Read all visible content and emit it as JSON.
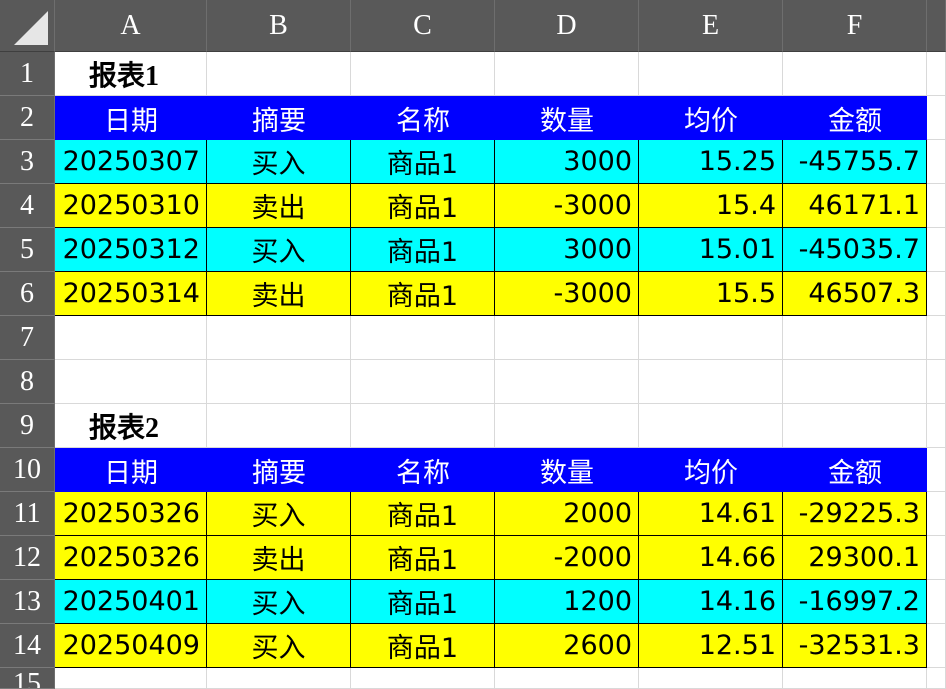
{
  "sheet": {
    "columns": [
      "A",
      "B",
      "C",
      "D",
      "E",
      "F"
    ],
    "rows": [
      "1",
      "2",
      "3",
      "4",
      "5",
      "6",
      "7",
      "8",
      "9",
      "10",
      "11",
      "12",
      "13",
      "14",
      "15"
    ],
    "report1": {
      "title": "报表1",
      "headers": [
        "日期",
        "摘要",
        "名称",
        "数量",
        "均价",
        "金额"
      ],
      "rows": [
        [
          "20250307",
          "买入",
          "商品1",
          "3000",
          "15.25",
          "-45755.7"
        ],
        [
          "20250310",
          "卖出",
          "商品1",
          "-3000",
          "15.4",
          "46171.1"
        ],
        [
          "20250312",
          "买入",
          "商品1",
          "3000",
          "15.01",
          "-45035.7"
        ],
        [
          "20250314",
          "卖出",
          "商品1",
          "-3000",
          "15.5",
          "46507.3"
        ]
      ],
      "row_fill": [
        "cyan",
        "yellow",
        "cyan",
        "yellow"
      ]
    },
    "report2": {
      "title": "报表2",
      "headers": [
        "日期",
        "摘要",
        "名称",
        "数量",
        "均价",
        "金额"
      ],
      "rows": [
        [
          "20250326",
          "买入",
          "商品1",
          "2000",
          "14.61",
          "-29225.3"
        ],
        [
          "20250326",
          "卖出",
          "商品1",
          "-2000",
          "14.66",
          "29300.1"
        ],
        [
          "20250401",
          "买入",
          "商品1",
          "1200",
          "14.16",
          "-16997.2"
        ],
        [
          "20250409",
          "买入",
          "商品1",
          "2600",
          "12.51",
          "-32531.3"
        ]
      ],
      "row_fill": [
        "yellow",
        "yellow",
        "cyan",
        "yellow"
      ]
    },
    "colors": {
      "header_bg": "#0000ff",
      "header_text": "#ffffff",
      "cyan": "#00ffff",
      "yellow": "#ffff00",
      "gridline": "#d9d9d9",
      "heading_bg": "#595959"
    }
  }
}
